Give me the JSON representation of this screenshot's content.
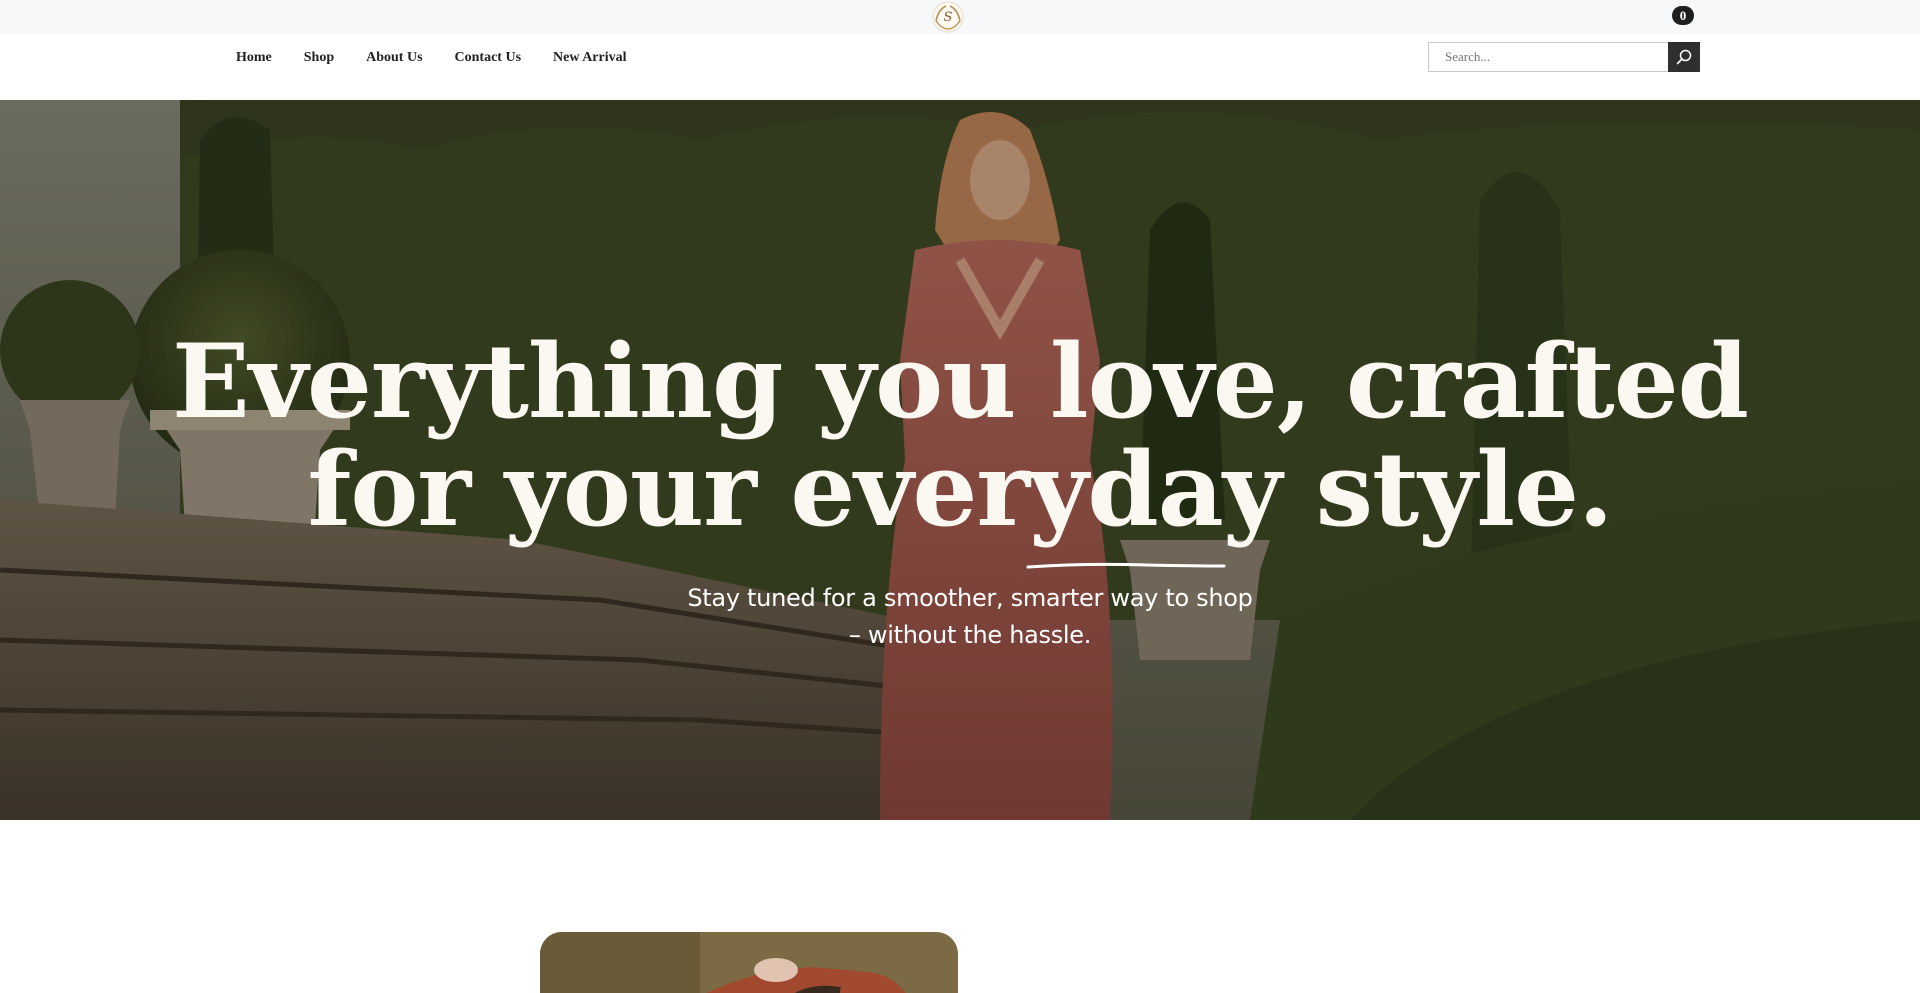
{
  "header": {
    "logo_letter": "S",
    "cart_count": "0"
  },
  "nav": {
    "items": [
      {
        "label": "Home"
      },
      {
        "label": "Shop"
      },
      {
        "label": "About Us"
      },
      {
        "label": "Contact Us"
      },
      {
        "label": "New Arrival"
      }
    ]
  },
  "search": {
    "placeholder": "Search...",
    "icon": "search-icon"
  },
  "hero": {
    "title_line1": "Everything you love, crafted",
    "title_line2": "for your everyday style.",
    "subtitle_line1": "Stay tuned for a smoother, smarter way to shop",
    "subtitle_line2": "– without the hassle."
  },
  "colors": {
    "topbar_bg": "#f7f8fa",
    "search_button": "#2f2f2f",
    "badge": "#1f1f1f",
    "hero_text": "#fbf7f1"
  }
}
